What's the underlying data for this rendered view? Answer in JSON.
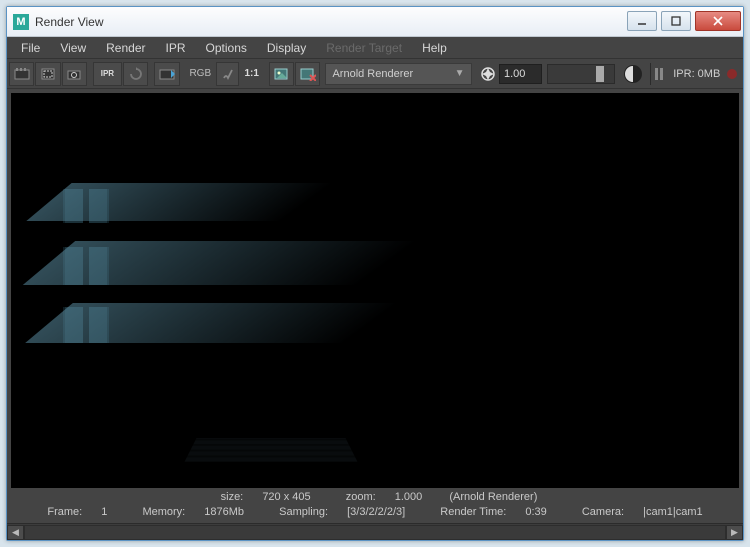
{
  "window": {
    "title": "Render View"
  },
  "menu": {
    "file": "File",
    "view": "View",
    "render": "Render",
    "ipr": "IPR",
    "options": "Options",
    "display": "Display",
    "render_target": "Render Target",
    "help": "Help"
  },
  "toolbar": {
    "rgb_label": "RGB",
    "ratio_label": "1:1",
    "ipr_label": "IPR",
    "renderer": "Arnold Renderer",
    "exposure": "1.00",
    "ipr_status": "IPR: 0MB"
  },
  "status": {
    "line1": {
      "size_label": "size:",
      "size_value": "720 x 405",
      "zoom_label": "zoom:",
      "zoom_value": "1.000",
      "renderer": "(Arnold Renderer)"
    },
    "line2": {
      "frame_label": "Frame:",
      "frame_value": "1",
      "memory_label": "Memory:",
      "memory_value": "1876Mb",
      "sampling_label": "Sampling:",
      "sampling_value": "[3/3/2/2/2/3]",
      "render_time_label": "Render Time:",
      "render_time_value": "0:39",
      "camera_label": "Camera:",
      "camera_value": "|cam1|cam1"
    }
  }
}
